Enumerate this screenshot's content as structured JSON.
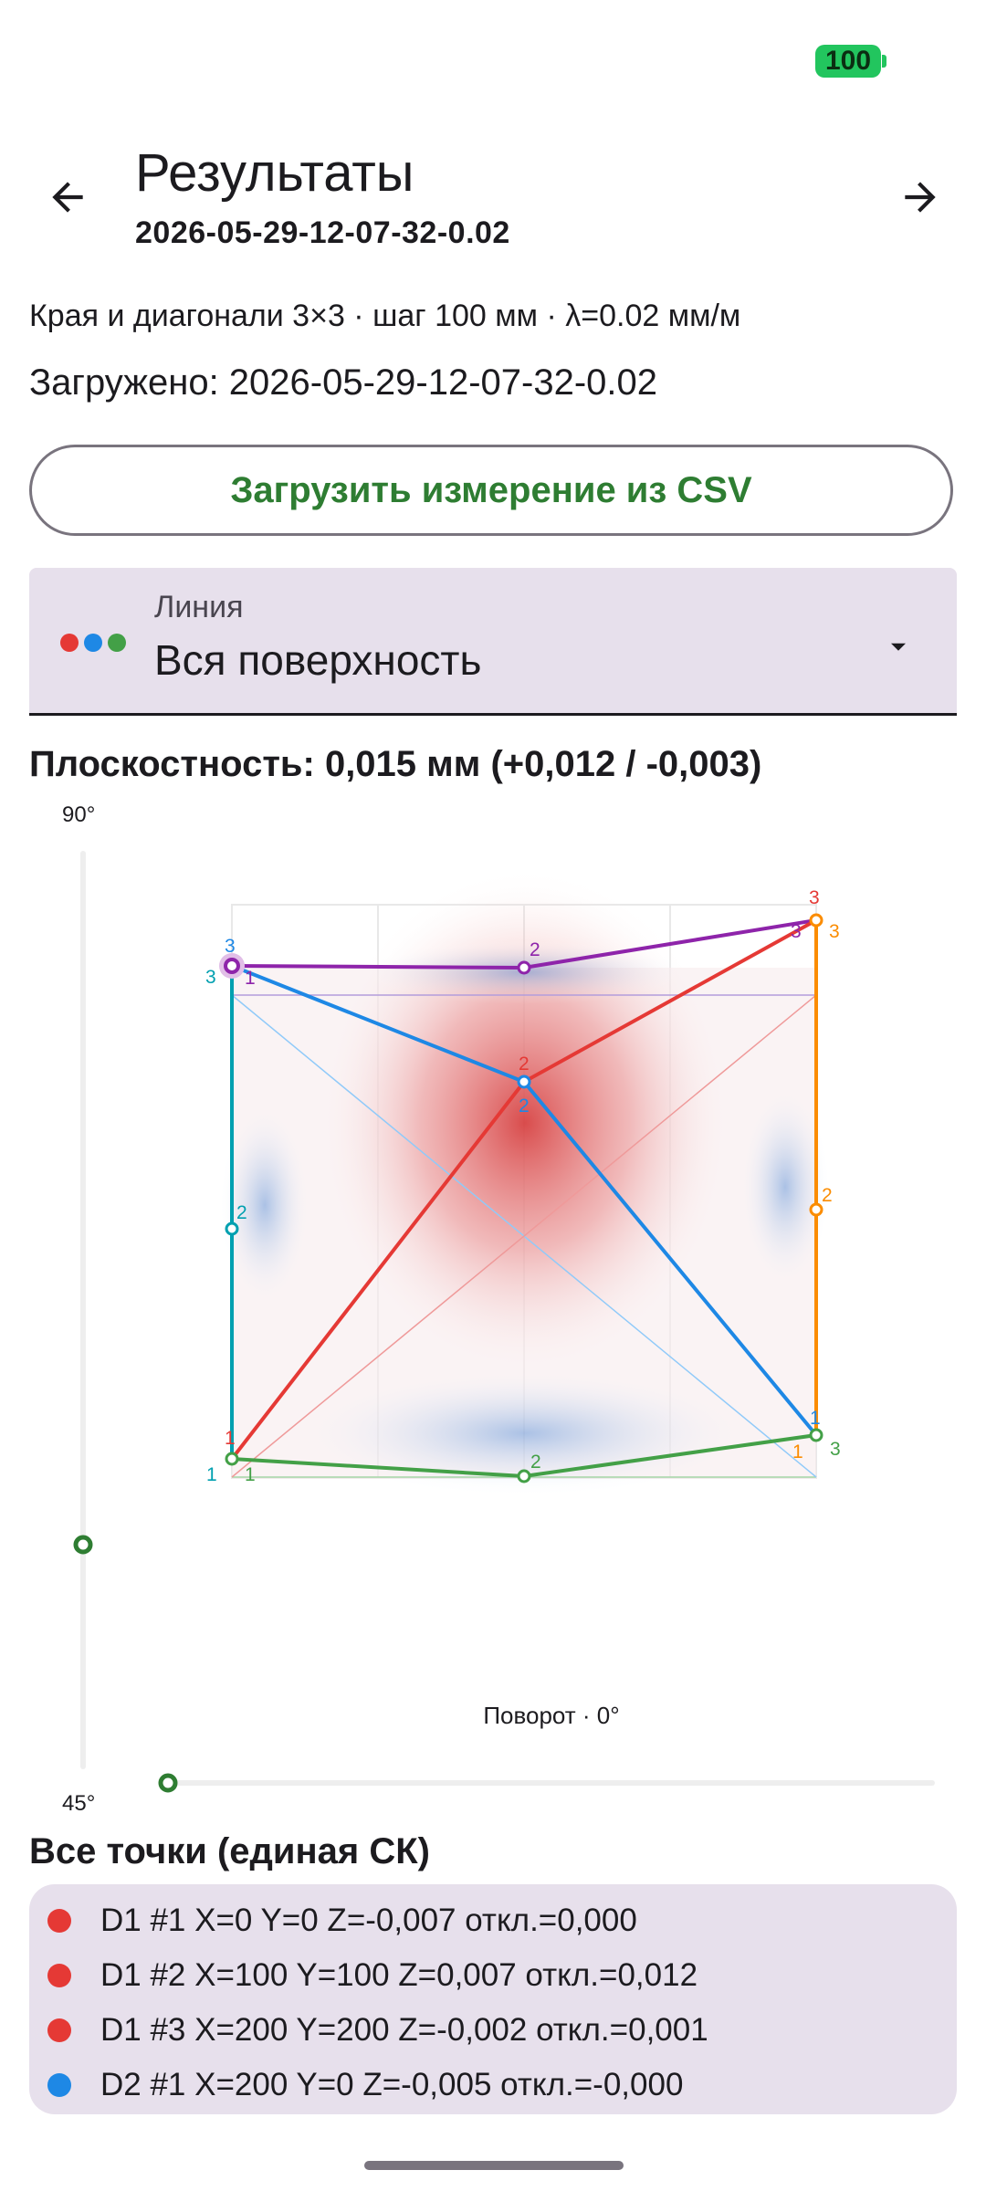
{
  "status": {
    "battery": "100"
  },
  "header": {
    "title": "Результаты",
    "subtitle": "2026-05-29-12-07-32-0.02",
    "back_icon": "arrow-left-icon",
    "forward_icon": "arrow-right-icon"
  },
  "info": {
    "method": "Края и диагонали 3×3 · шаг 100 мм · λ=0.02 мм/м",
    "loaded": "Загружено: 2026-05-29-12-07-32-0.02"
  },
  "csv_button": {
    "label": "Загрузить измерение из CSV"
  },
  "line_select": {
    "label": "Линия",
    "value": "Вся поверхность",
    "dot_colors": [
      "#e53935",
      "#1e88e5",
      "#43a047"
    ]
  },
  "flatness": {
    "text": "Плоскостность: 0,015 мм (+0,012 / -0,003)"
  },
  "view": {
    "tilt_top_label": "90°",
    "tilt_bottom_label": "45°",
    "rotation_label": "Поворот · 0°"
  },
  "colors": {
    "accent_green": "#2e7d32",
    "line_purple": "#8e24aa",
    "line_red": "#e53935",
    "line_blue": "#1e88e5",
    "line_teal": "#00a0b0",
    "line_orange": "#fb8c00",
    "line_green": "#43a047"
  },
  "points": {
    "title": "Все точки (единая СК)",
    "items": [
      {
        "text": "D1 #1 X=0 Y=0 Z=-0,007 откл.=0,000",
        "color": "#e53935"
      },
      {
        "text": "D1 #2 X=100 Y=100 Z=0,007 откл.=0,012",
        "color": "#e53935"
      },
      {
        "text": "D1 #3 X=200 Y=200 Z=-0,002 откл.=0,001",
        "color": "#e53935"
      },
      {
        "text": "D2 #1 X=200 Y=0 Z=-0,005 откл.=-0,000",
        "color": "#1e88e5"
      }
    ]
  },
  "surface_labels": {
    "one": "1",
    "two": "2",
    "three": "3"
  }
}
